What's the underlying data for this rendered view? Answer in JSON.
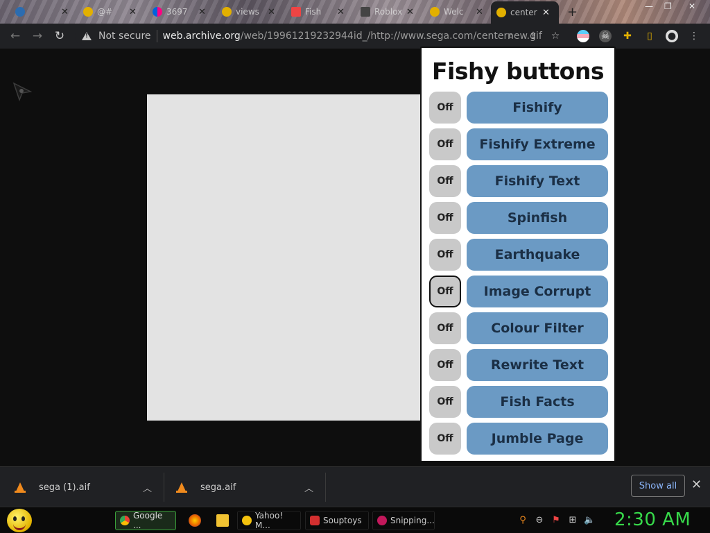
{
  "browser": {
    "tabs": [
      {
        "label": "",
        "favicon": "wordpress-icon"
      },
      {
        "label": "@#",
        "favicon": "smiley-icon"
      },
      {
        "label": "3697",
        "favicon": "flickr-icon"
      },
      {
        "label": "views",
        "favicon": "smiley-icon"
      },
      {
        "label": "Fish",
        "favicon": "page-icon"
      },
      {
        "label": "Roblox",
        "favicon": "roblox-icon"
      },
      {
        "label": "Welc",
        "favicon": "smiley-icon"
      },
      {
        "label": "center",
        "favicon": "smiley-icon",
        "active": true
      }
    ],
    "security": "Not secure",
    "url_host": "web.archive.org",
    "url_rest": "/web/19961219232944id_/http://www.sega.com/centernew.gif"
  },
  "fishy": {
    "title": "Fishy buttons",
    "toggle_label": "Off",
    "buttons": [
      "Fishify",
      "Fishify Extreme",
      "Fishify Text",
      "Spinfish",
      "Earthquake",
      "Image Corrupt",
      "Colour Filter",
      "Rewrite Text",
      "Fish Facts",
      "Jumble Page"
    ],
    "focused_index": 5
  },
  "downloads": {
    "items": [
      "sega (1).aif",
      "sega.aif"
    ],
    "show_all": "Show all"
  },
  "taskbar": {
    "tasks": [
      "Google ...",
      "Yahoo! M...",
      "Souptoys",
      "Snipping..."
    ],
    "clock": "2:30 AM"
  },
  "colors": {
    "fishy_button": "#6b9ac4",
    "off_toggle": "#c9c9c9",
    "clock": "#37d94a",
    "link": "#8ab4f8"
  }
}
